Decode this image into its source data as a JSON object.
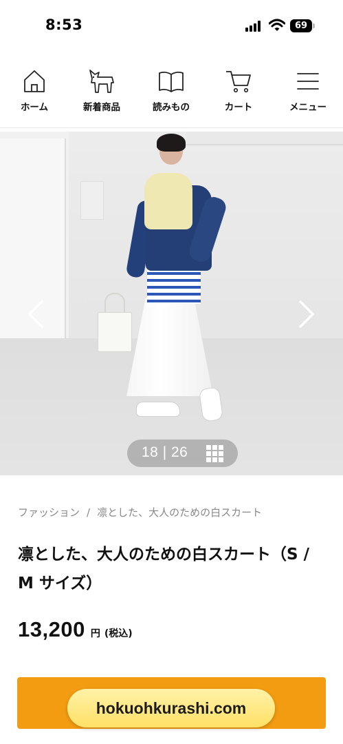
{
  "status_bar": {
    "time": "8:53",
    "battery": "69"
  },
  "nav": {
    "items": [
      {
        "label": "ホーム",
        "icon": "home-icon"
      },
      {
        "label": "新着商品",
        "icon": "horse-icon"
      },
      {
        "label": "読みもの",
        "icon": "book-icon"
      },
      {
        "label": "カート",
        "icon": "cart-icon"
      },
      {
        "label": "メニュー",
        "icon": "menu-icon"
      }
    ]
  },
  "gallery": {
    "counter": "18 | 26",
    "prev_icon": "chevron-left-icon",
    "next_icon": "chevron-right-icon",
    "grid_icon": "grid-icon"
  },
  "product": {
    "breadcrumb": {
      "category": "ファッション",
      "separator": "/",
      "current": "凛とした、大人のための白スカート"
    },
    "title": "凛とした、大人のための白スカート（S / M サイズ）",
    "price": "13,200",
    "currency": "円",
    "tax_note": "(税込)"
  },
  "overlay": {
    "domain": "hokuohkurashi.com"
  },
  "colors": {
    "accent": "#f39c12",
    "pill": "#ffe066"
  }
}
